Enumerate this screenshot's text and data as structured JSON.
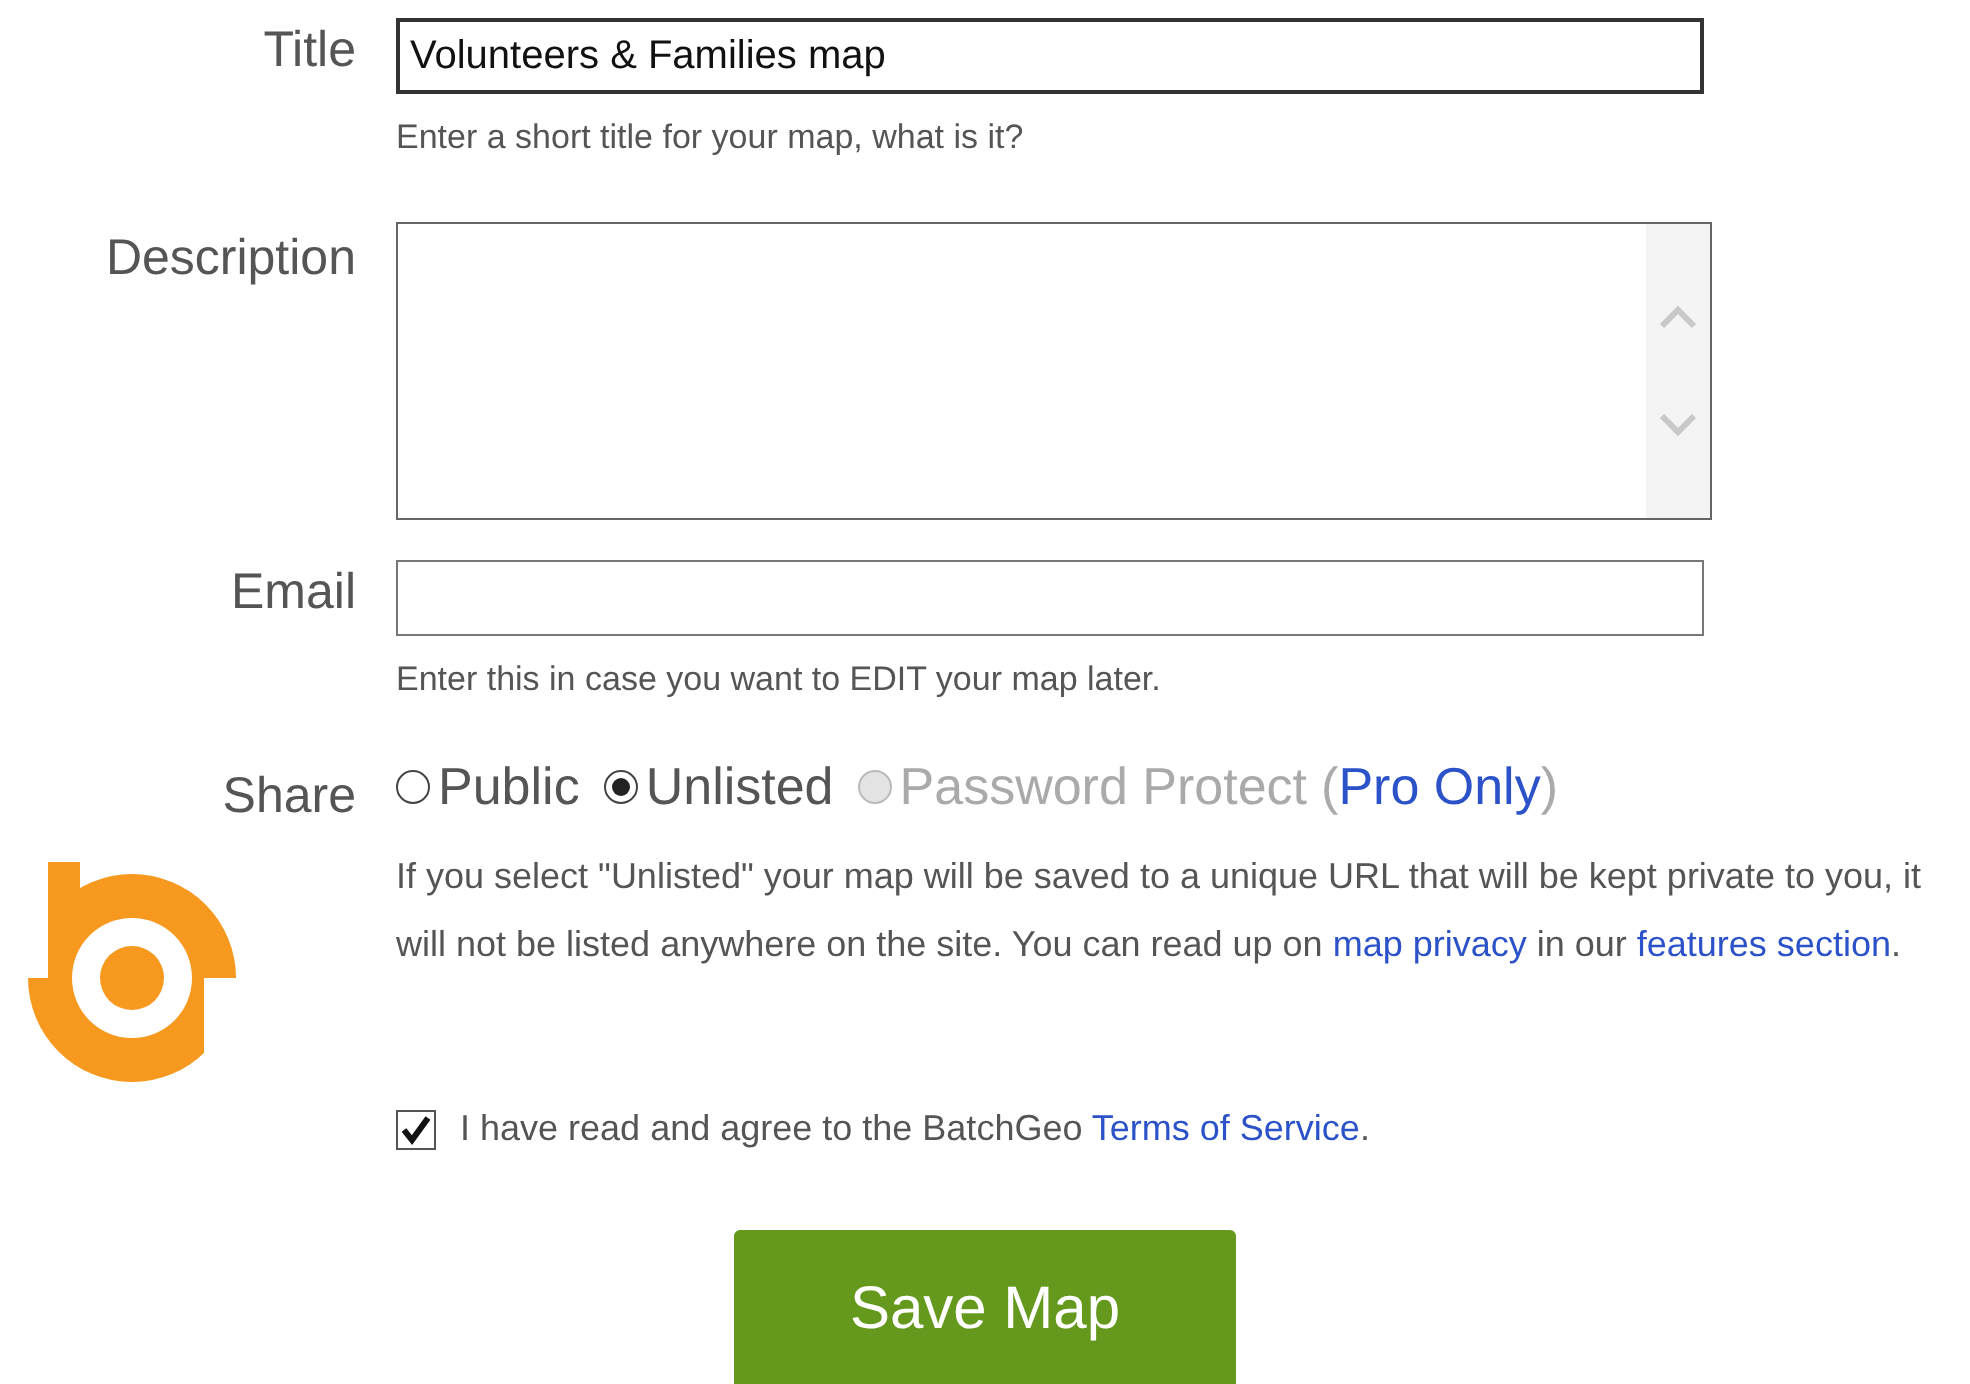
{
  "form": {
    "fields": [
      {
        "kind": "text",
        "label": "Title",
        "value": "Volunteers & Families map",
        "hint": "Enter a short title for your map, what is it?"
      },
      {
        "kind": "textarea",
        "label": "Description"
      },
      {
        "kind": "text",
        "label": "Email",
        "hint": "Enter this in case you want to EDIT your map later."
      }
    ],
    "share": {
      "label": "Share",
      "options": [
        {
          "label": "Public",
          "selected": false,
          "disabled": false
        },
        {
          "label": "Unlisted",
          "selected": true,
          "disabled": false
        },
        {
          "label": "Password Protect",
          "selected": false,
          "disabled": true,
          "note": [
            {
              "kind": "text",
              "text": "("
            },
            {
              "kind": "link",
              "text": "Pro Only"
            },
            {
              "kind": "text",
              "text": ")"
            }
          ]
        }
      ],
      "help": [
        {
          "kind": "text",
          "text": "If you select \"Unlisted\" your map will be saved to a unique URL that will be kept private to you, it will not be listed anywhere on the site. You can read up on "
        },
        {
          "kind": "link",
          "text": "map privacy"
        },
        {
          "kind": "text",
          "text": " in our "
        },
        {
          "kind": "link",
          "text": "features section"
        },
        {
          "kind": "text",
          "text": "."
        }
      ]
    },
    "terms": {
      "checked": true,
      "parts": [
        {
          "kind": "text",
          "text": "I have read and agree to the BatchGeo "
        },
        {
          "kind": "link",
          "text": "Terms of Service"
        },
        {
          "kind": "text",
          "text": "."
        }
      ]
    },
    "submit": "Save Map"
  }
}
